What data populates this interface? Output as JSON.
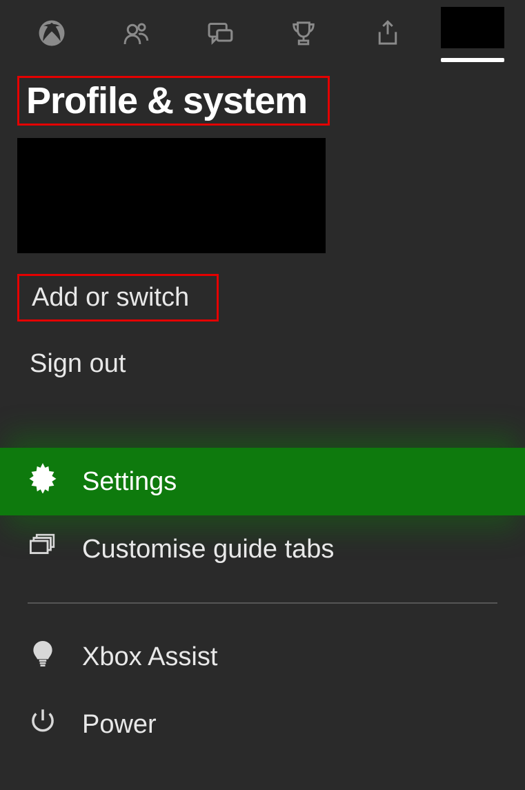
{
  "header": {
    "title": "Profile & system",
    "tabs": {
      "home_icon": "xbox-logo",
      "people_icon": "people",
      "chat_icon": "chat",
      "achievements_icon": "trophy",
      "share_icon": "share",
      "avatar_icon": "user-avatar"
    }
  },
  "account": {
    "add_switch": "Add or switch",
    "sign_out": "Sign out"
  },
  "menu": {
    "settings": "Settings",
    "customise": "Customise guide tabs",
    "assist": "Xbox Assist",
    "power": "Power"
  }
}
